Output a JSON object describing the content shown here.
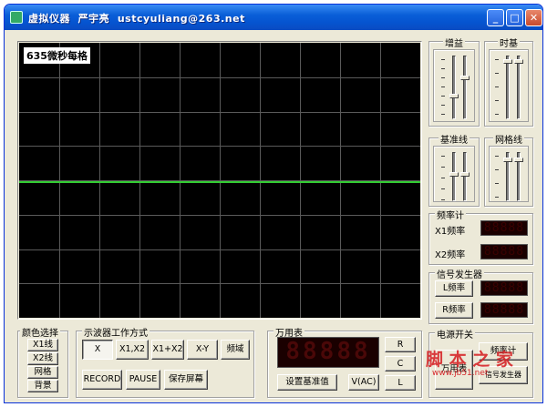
{
  "window": {
    "title": "虚拟仪器  严宇亮  ustcyuliang@263.net",
    "controls": {
      "minimize": "_",
      "maximize": "□",
      "close": "✕"
    }
  },
  "scope": {
    "timebase_label": "635微秒每格",
    "grid": {
      "cols": 10,
      "rows": 8
    },
    "trace_color": "#33cc33",
    "background": "#000000"
  },
  "sliders": {
    "gain": "增益",
    "timebase": "时基",
    "baseline": "基准线",
    "gridline": "网格线"
  },
  "freq_meter": {
    "title": "频率计",
    "x1_label": "X1频率",
    "x2_label": "X2频率",
    "x1_value": "88888",
    "x2_value": "88888"
  },
  "signal_gen": {
    "title": "信号发生器",
    "l_button": "L频率",
    "r_button": "R频率",
    "l_value": "88888",
    "r_value": "88888"
  },
  "color_select": {
    "title": "颜色选择",
    "items": [
      "X1线",
      "X2线",
      "网格",
      "背景"
    ]
  },
  "mode": {
    "title": "示波器工作方式",
    "buttons": [
      "X",
      "X1,X2",
      "X1+X2",
      "X-Y",
      "频域"
    ],
    "actions": [
      "RECORD",
      "PAUSE",
      "保存屏幕"
    ]
  },
  "multimeter": {
    "title": "万用表",
    "display": "88888",
    "side_buttons": [
      "R",
      "C",
      "L"
    ],
    "set_baseline": "设置基准值",
    "vac": "V(AC)"
  },
  "power": {
    "title": "电源开关",
    "multimeter": "万用表",
    "freq_meter": "频率计",
    "signal": "信号发生器"
  },
  "watermark": {
    "text": "脚 本 之 家",
    "url": "www.jb51.net"
  }
}
